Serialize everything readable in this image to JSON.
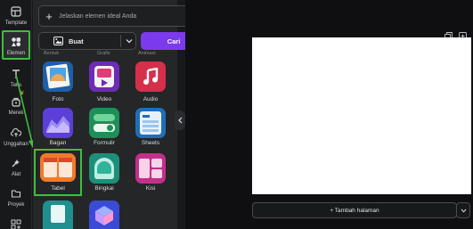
{
  "rail": {
    "items": [
      {
        "label": "Template",
        "icon": "template-icon"
      },
      {
        "label": "Elemen",
        "icon": "elements-icon"
      },
      {
        "label": "Teks",
        "icon": "text-icon"
      },
      {
        "label": "Merek",
        "icon": "brand-icon"
      },
      {
        "label": "Unggahan",
        "icon": "upload-icon"
      },
      {
        "label": "Alat",
        "icon": "tools-icon"
      },
      {
        "label": "Proyek",
        "icon": "folder-icon"
      }
    ]
  },
  "search": {
    "placeholder": "Jelaskan elemen ideal Anda"
  },
  "generate": {
    "mode_label": "Buat",
    "submit_label": "Cari"
  },
  "cut_labels": [
    "Bentuk",
    "Grafis",
    "Animasi"
  ],
  "elements": [
    {
      "label": "Foto",
      "icon": "photo-icon"
    },
    {
      "label": "Video",
      "icon": "video-icon"
    },
    {
      "label": "Audio",
      "icon": "audio-icon"
    },
    {
      "label": "Bagan",
      "icon": "chart-icon"
    },
    {
      "label": "Formulir",
      "icon": "form-icon"
    },
    {
      "label": "Sheets",
      "icon": "sheets-icon"
    },
    {
      "label": "Tabel",
      "icon": "table-icon"
    },
    {
      "label": "Bingkai",
      "icon": "frame-icon"
    },
    {
      "label": "Kisi",
      "icon": "grid-icon"
    }
  ],
  "canvas": {
    "add_page_label": "+ Tambah halaman"
  },
  "colors": {
    "accent": "#7c3aed",
    "highlight": "#3fbf3f"
  }
}
